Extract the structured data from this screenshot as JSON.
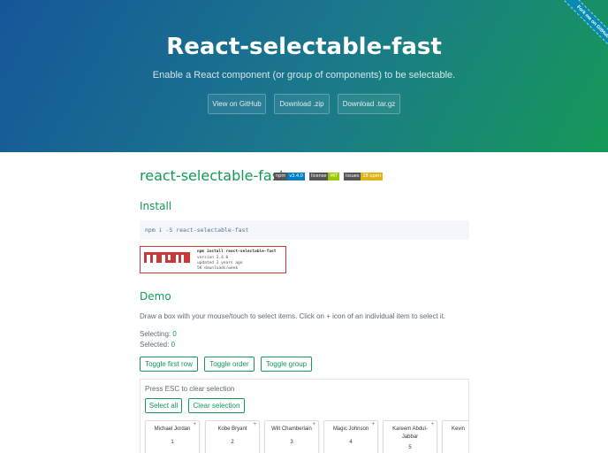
{
  "header": {
    "title": "React-selectable-fast",
    "tagline": "Enable a React component (or group of components) to be selectable.",
    "buttons": [
      "View on GitHub",
      "Download .zip",
      "Download .tar.gz"
    ],
    "ribbon": "Fork me on GitHub"
  },
  "package": {
    "name": "react-selectable-fast",
    "badges": [
      {
        "key": "npm",
        "value": "v3.4.0",
        "color": "#007ec6"
      },
      {
        "key": "license",
        "value": "MIT",
        "color": "#97ca00"
      },
      {
        "key": "issues",
        "value": "28 open",
        "color": "#dfb317"
      }
    ]
  },
  "install": {
    "heading": "Install",
    "command": "npm i -S react-selectable-fast",
    "npm_card": {
      "line1": "npm install react-selectable-fast",
      "line2": "version 3.4.0",
      "line3": "updated 3 years ago",
      "line4": "5K downloads/week"
    }
  },
  "demo": {
    "heading": "Demo",
    "description": "Draw a box with your mouse/touch to select items. Click on + icon of an individual item to select it.",
    "selecting_label": "Selecting:",
    "selecting_value": "0",
    "selected_label": "Selected:",
    "selected_value": "0",
    "toggle_buttons": [
      "Toggle first row",
      "Toggle order",
      "Toggle group"
    ],
    "esc_hint": "Press ESC to clear selection",
    "select_all": "Select all",
    "clear_selection": "Clear selection",
    "cards": [
      {
        "name": "Michael Jordan",
        "index": "1"
      },
      {
        "name": "Kobe Bryant",
        "index": "2"
      },
      {
        "name": "Wilt Chamberlain",
        "index": "3"
      },
      {
        "name": "Magic Johnson",
        "index": "4"
      },
      {
        "name": "Kareem Abdul-Jabbar",
        "index": "5"
      },
      {
        "name": "Kevin",
        "index": ""
      }
    ],
    "card_add_icon": "+"
  },
  "colors": {
    "accent": "#159957",
    "hero_start": "#155799",
    "hero_end": "#159957",
    "npm_red": "#cb3837"
  }
}
